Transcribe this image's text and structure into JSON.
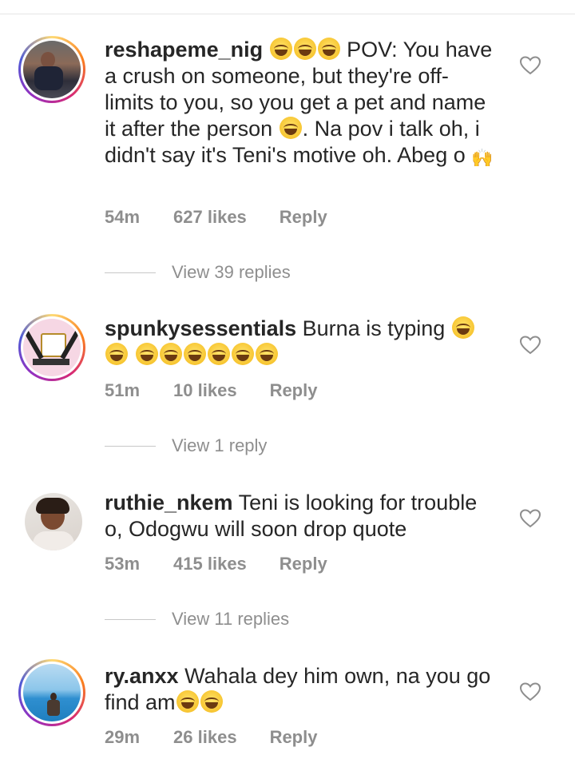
{
  "comments": [
    {
      "username": "reshapeme_nig",
      "text_before_emoji": "POV: You have a crush on someone, but they're off-limits to you, so you get a pet and name it after the person",
      "text_after": ". Na pov i talk oh, i didn't say it's Teni's motive oh. Abeg o",
      "time": "54m",
      "likes": "627 likes",
      "reply_label": "Reply",
      "view_replies": "View 39 replies",
      "avatar_icon": "woman-photo-icon"
    },
    {
      "username": "spunkysessentials",
      "text": "Burna is typing",
      "time": "51m",
      "likes": "10 likes",
      "reply_label": "Reply",
      "view_replies": "View 1 reply",
      "avatar_icon": "salon-tools-logo-icon"
    },
    {
      "username": "ruthie_nkem",
      "text": "Teni is looking for trouble o, Odogwu will soon drop quote",
      "time": "53m",
      "likes": "415 likes",
      "reply_label": "Reply",
      "view_replies": "View 11 replies",
      "avatar_icon": "woman-portrait-icon"
    },
    {
      "username": "ry.anxx",
      "text": "Wahala dey him own, na you go find am",
      "time": "29m",
      "likes": "26 likes",
      "reply_label": "Reply",
      "avatar_icon": "beach-photo-icon"
    }
  ],
  "colors": {
    "text": "#262626",
    "meta": "#8e8e8e",
    "story_ring": "#d62976"
  }
}
